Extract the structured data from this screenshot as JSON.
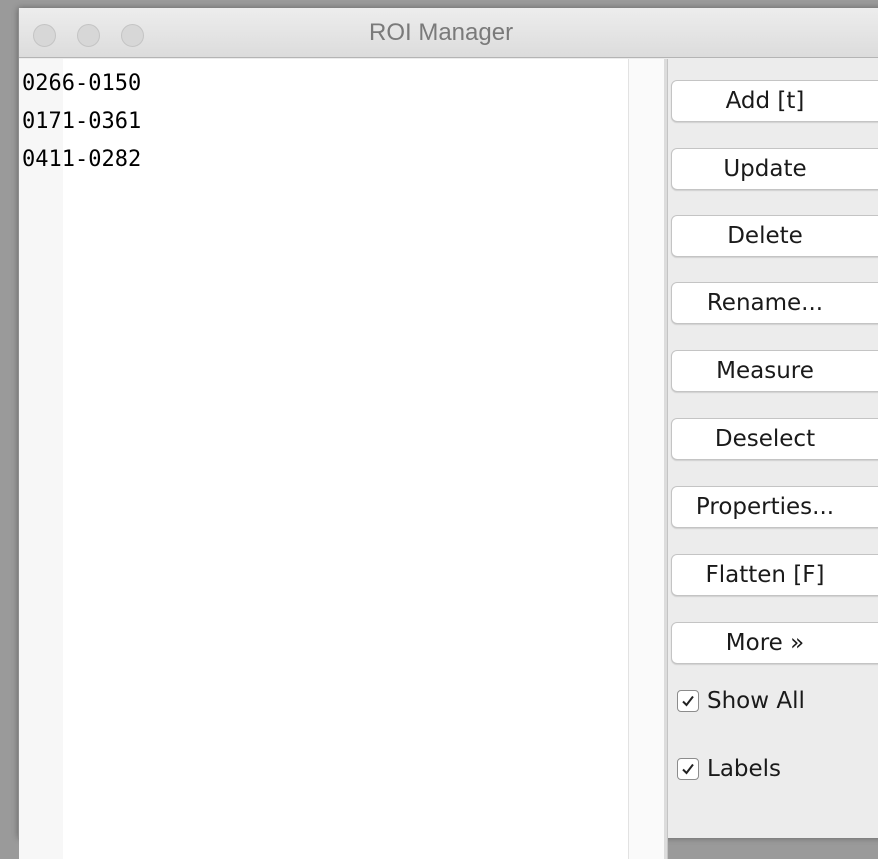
{
  "window": {
    "title": "ROI Manager"
  },
  "roi_list": {
    "items": [
      "0266-0150",
      "0171-0361",
      "0411-0282"
    ]
  },
  "buttons": {
    "add": "Add [t]",
    "update": "Update",
    "delete": "Delete",
    "rename": "Rename...",
    "measure": "Measure",
    "deselect": "Deselect",
    "properties": "Properties...",
    "flatten": "Flatten [F]",
    "more": "More »"
  },
  "options": {
    "show_all": {
      "label": "Show All",
      "checked": true
    },
    "labels": {
      "label": "Labels",
      "checked": true
    }
  },
  "colors": {
    "window_bg": "#ececec",
    "list_bg": "#ffffff",
    "title_text": "#7a7a7a"
  }
}
